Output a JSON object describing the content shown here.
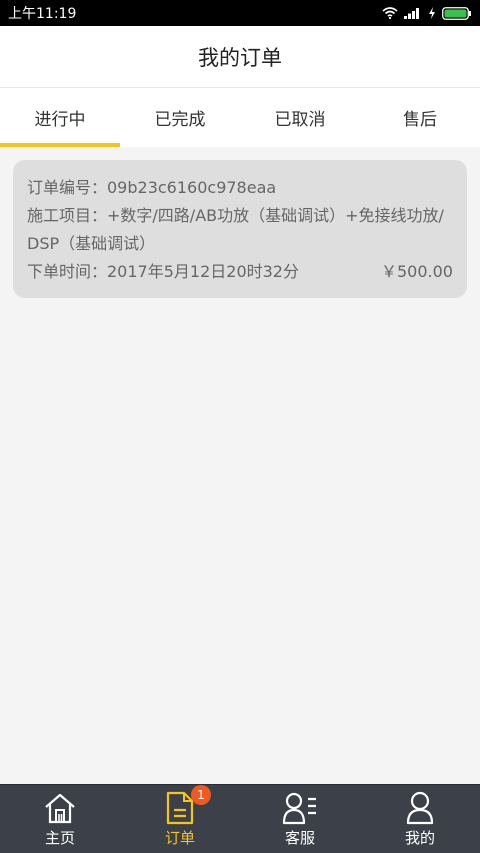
{
  "status_bar": {
    "time": "上午11:19"
  },
  "header": {
    "title": "我的订单"
  },
  "tabs": [
    {
      "label": "进行中",
      "active": true
    },
    {
      "label": "已完成",
      "active": false
    },
    {
      "label": "已取消",
      "active": false
    },
    {
      "label": "售后",
      "active": false
    }
  ],
  "order": {
    "number": "订单编号：09b23c6160c978eaa",
    "service": "施工项目：+数字/四路/AB功放（基础调试）+免接线功放/DSP（基础调试）",
    "time": "下单时间：2017年5月12日20时32分",
    "price": "￥500.00"
  },
  "bottom_nav": [
    {
      "label": "主页",
      "icon": "home-icon"
    },
    {
      "label": "订单",
      "icon": "order-icon",
      "badge": "1"
    },
    {
      "label": "客服",
      "icon": "customer-service-icon"
    },
    {
      "label": "我的",
      "icon": "profile-icon"
    }
  ],
  "colors": {
    "accent": "#f5c518",
    "badge": "#f05a22",
    "nav_bg": "#3c4048"
  }
}
